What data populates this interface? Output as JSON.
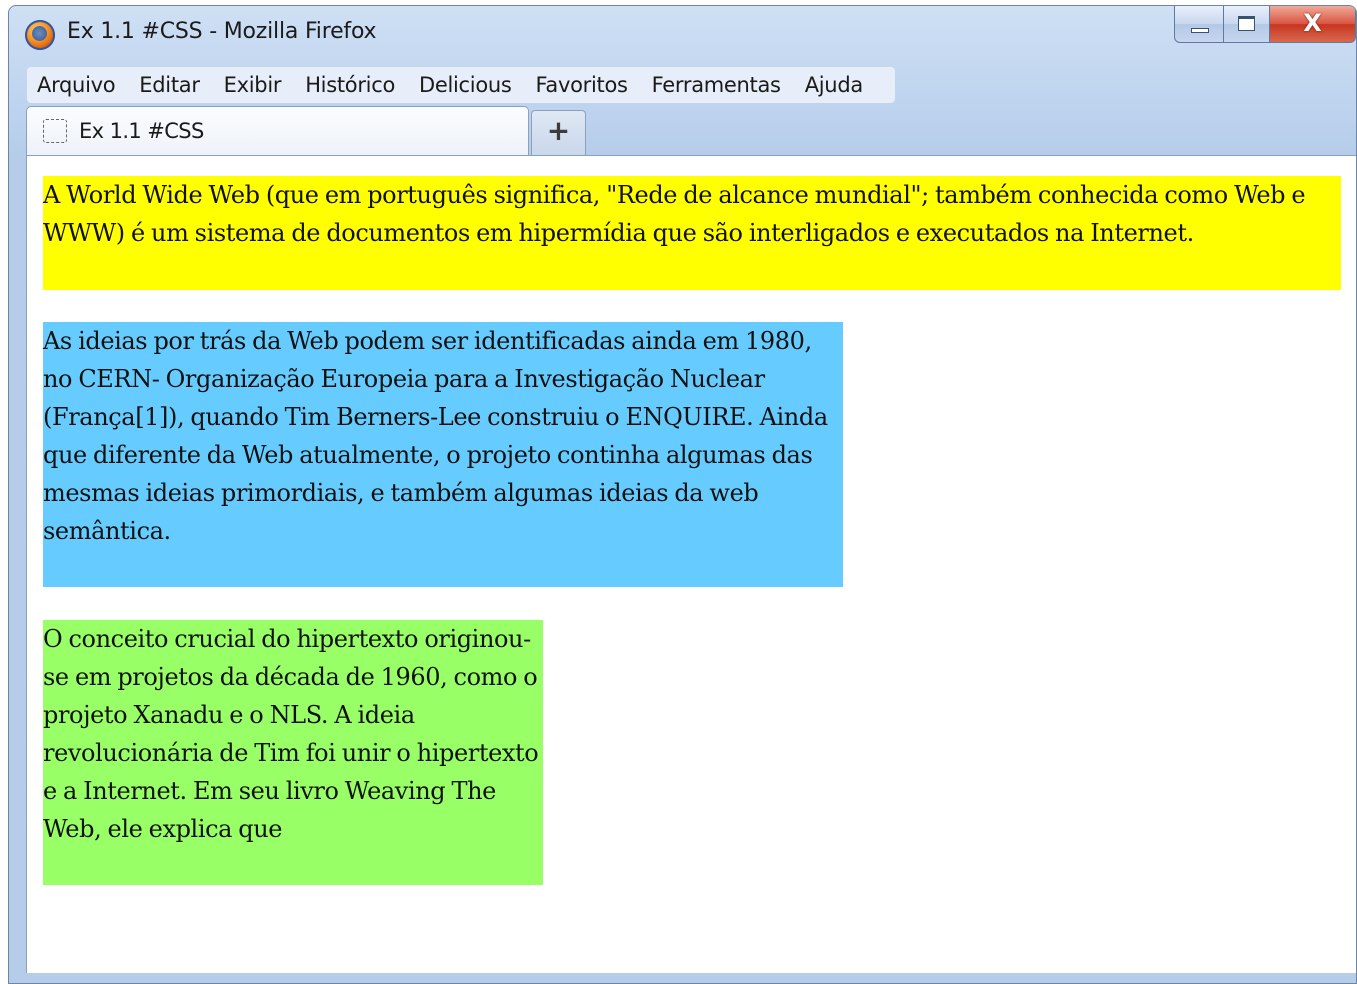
{
  "window": {
    "title": "Ex 1.1 #CSS - Mozilla Firefox",
    "app_icon": "firefox-icon",
    "controls": {
      "minimize_icon": "minimize-icon",
      "maximize_icon": "maximize-icon",
      "close_glyph": "X"
    }
  },
  "menubar": {
    "items": [
      {
        "label": "Arquivo"
      },
      {
        "label": "Editar"
      },
      {
        "label": "Exibir"
      },
      {
        "label": "Histórico"
      },
      {
        "label": "Delicious"
      },
      {
        "label": "Favoritos"
      },
      {
        "label": "Ferramentas"
      },
      {
        "label": "Ajuda"
      }
    ]
  },
  "tabs": [
    {
      "label": "Ex 1.1 #CSS",
      "favicon": "blank-page-icon",
      "active": true
    }
  ],
  "new_tab_label": "+",
  "page": {
    "paragraphs": [
      {
        "text": "A World Wide Web (que em português significa, \"Rede de alcance mundial\"; também conhecida como Web e WWW) é um sistema de documentos em hipermídia que são interligados e executados na Internet.",
        "background": "#ffff00"
      },
      {
        "text": "As ideias por trás da Web podem ser identificadas ainda em 1980, no CERN- Organização Europeia para a Investigação Nuclear (França[1]), quando Tim Berners-Lee construiu o ENQUIRE. Ainda que diferente da Web atualmente, o projeto continha algumas das mesmas ideias primordiais, e também algumas ideias da web semântica.",
        "background": "#66ccff"
      },
      {
        "text": "O conceito crucial do hipertexto originou-se em projetos da década de 1960, como o projeto Xanadu e o NLS. A ideia revolucionária de Tim foi unir o hipertexto e a Internet. Em seu livro Weaving The Web, ele explica que",
        "background": "#99ff66"
      }
    ]
  }
}
